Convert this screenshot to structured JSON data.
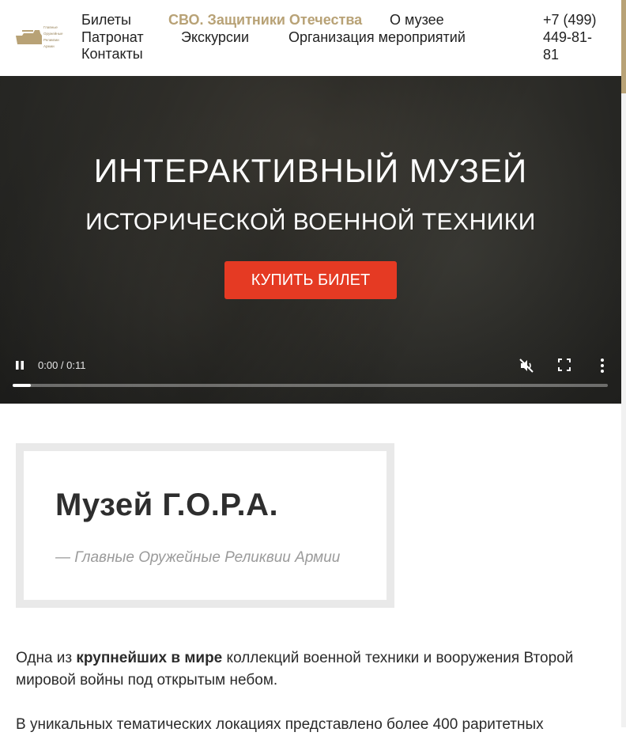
{
  "header": {
    "logo_lines": [
      "Главные",
      "Оружейные",
      "Реликвии",
      "Армии"
    ],
    "nav": {
      "tickets": "Билеты",
      "svo": "СВО. Защитники Отечества",
      "about": "О музее",
      "patronage": "Патронат",
      "excursions": "Экскурсии",
      "events": "Организация мероприятий",
      "contacts": "Контакты"
    },
    "phone_lines": [
      "+7 (499)",
      "449-81-",
      "81"
    ]
  },
  "hero": {
    "title": "ИНТЕРАКТИВНЫЙ МУЗЕЙ",
    "subtitle": "ИСТОРИЧЕСКОЙ ВОЕННОЙ ТЕХНИКИ",
    "buy_button": "КУПИТЬ БИЛЕТ",
    "video": {
      "time": "0:00 / 0:11",
      "progress": 0.03,
      "state": "playing",
      "muted": true
    }
  },
  "museum": {
    "title": "Музей Г.О.Р.А.",
    "subtitle": "— Главные Оружейные Реликвии Армии"
  },
  "intro": {
    "p1_before": "Одна из ",
    "p1_bold": "крупнейших в мире",
    "p1_after": " коллекций военной техники и вооружения Второй мировой войны под открытым небом.",
    "p2": "В уникальных тематических локациях представлено более 400 раритетных"
  },
  "colors": {
    "accent": "#b8a276",
    "button": "#e53a23",
    "card_frame": "#e9e9e9"
  }
}
